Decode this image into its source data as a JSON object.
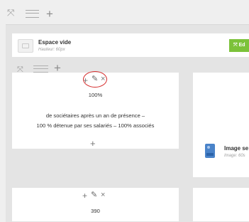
{
  "toolbar": {
    "add_symbol": "+"
  },
  "empty_block": {
    "title": "Espace vide",
    "subtitle": "Hauteur: 60px",
    "action_label": "Ed",
    "action_color": "#7cc23a"
  },
  "row_toolbar": {
    "add_symbol": "+"
  },
  "text_block": {
    "percent": "100%",
    "line1": "de sociétaires après un an de présence –",
    "line2": "100 % détenue par ses salariés – 100% associés",
    "add_symbol": "+",
    "highlight_color": "#d52b2b"
  },
  "image_block": {
    "title": "Image se",
    "subtitle": "Image: 60s"
  },
  "bottom_block": {
    "value": "390"
  }
}
